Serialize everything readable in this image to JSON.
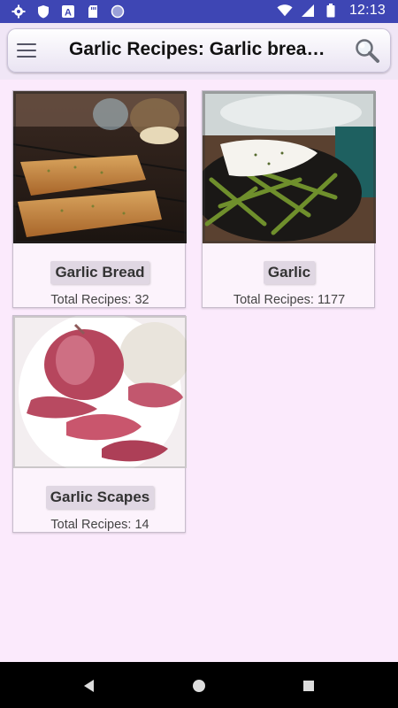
{
  "status_bar": {
    "time": "12:13",
    "left_icons": [
      "gear-icon",
      "shield-icon",
      "a-box-icon",
      "sd-card-icon",
      "circle-icon"
    ],
    "right_icons": [
      "wifi-icon",
      "signal-icon",
      "battery-icon"
    ]
  },
  "app_bar": {
    "title": "Garlic Recipes: Garlic bread,…",
    "menu_icon": "hamburger-menu-icon",
    "search_icon": "magnifier-search-icon"
  },
  "cards": [
    {
      "name": "Garlic Bread",
      "count": "Total Recipes: 32",
      "image": "garlic-bread-photo"
    },
    {
      "name": "Garlic",
      "count": "Total Recipes: 1177",
      "image": "green-beans-garlic-photo"
    },
    {
      "name": "Garlic Scapes",
      "count": "Total Recipes: 14",
      "image": "garlic-bulbs-photo"
    }
  ],
  "nav_bar": {
    "icons": [
      "back-icon",
      "home-icon",
      "recents-icon"
    ]
  },
  "colors": {
    "status_bar": "#3e46b4",
    "background": "#fbeafc",
    "label_bg": "#e0d7e3"
  }
}
